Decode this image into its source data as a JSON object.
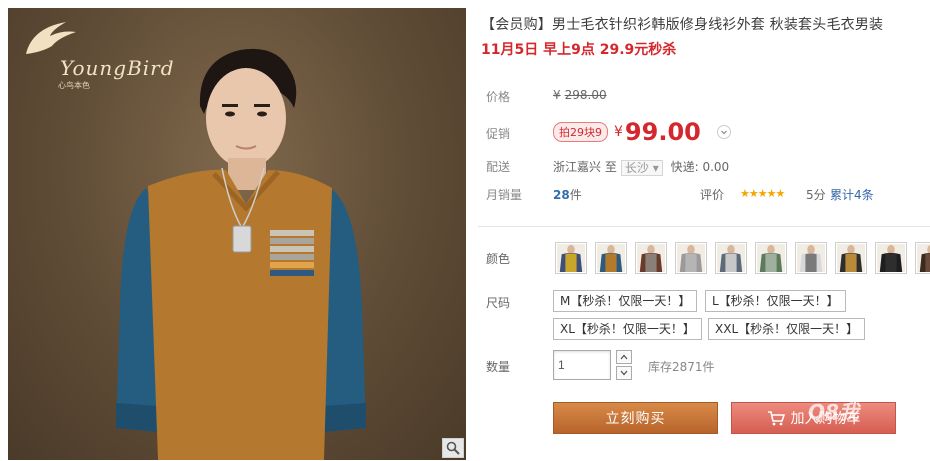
{
  "brand": {
    "logo_text": "YoungBird",
    "logo_sub": "心鸟本色"
  },
  "product": {
    "title": "【会员购】男士毛衣针织衫韩版修身线衫外套 秋装套头毛衣男装",
    "promo": "11月5日 早上9点 29.9元秒杀"
  },
  "price": {
    "label": "价格",
    "currency": "¥",
    "original": "298.00",
    "sale_label": "促销",
    "badge": "拍29块9",
    "sale_currency": "¥",
    "sale_value": "99.00"
  },
  "shipping": {
    "label": "配送",
    "from": "浙江嘉兴",
    "to_word": "至",
    "city": "长沙",
    "fee_label": "快递:",
    "fee": "0.00"
  },
  "sales": {
    "label": "月销量",
    "count": "28",
    "unit": "件",
    "rating_label": "评价",
    "stars": "★★★★★",
    "score": "5分",
    "reviews": "累计4条"
  },
  "color": {
    "label": "颜色",
    "swatches": [
      {
        "name": "swatch-1",
        "body": "#c9a62a",
        "sleeve": "#3d4f7a"
      },
      {
        "name": "swatch-2",
        "body": "#b47a2c",
        "sleeve": "#2b5b7e"
      },
      {
        "name": "swatch-3",
        "body": "#8a8078",
        "sleeve": "#6a3a2a"
      },
      {
        "name": "swatch-4",
        "body": "#b5b5b5",
        "sleeve": "#9a9a9a"
      },
      {
        "name": "swatch-5",
        "body": "#c8c8c8",
        "sleeve": "#5d6a7a"
      },
      {
        "name": "swatch-6",
        "body": "#9fb0a0",
        "sleeve": "#5c7a5c"
      },
      {
        "name": "swatch-7",
        "body": "#7a7a7a",
        "sleeve": "#d8d8d8"
      },
      {
        "name": "swatch-8",
        "body": "#b88a3a",
        "sleeve": "#2e2e2e"
      },
      {
        "name": "swatch-9",
        "body": "#2e2e2e",
        "sleeve": "#1e1e1e"
      },
      {
        "name": "swatch-10",
        "body": "#6a4a3a",
        "sleeve": "#3a2a20"
      }
    ]
  },
  "size": {
    "label": "尺码",
    "options": [
      "M【秒杀！仅限一天！】",
      "L【秒杀！仅限一天！】",
      "XL【秒杀！仅限一天！】",
      "XXL【秒杀！仅限一天！】"
    ]
  },
  "quantity": {
    "label": "数量",
    "value": "1",
    "stock": "库存2871件"
  },
  "actions": {
    "buy": "立刻购买",
    "cart": "加入购物车",
    "watermark": "Q8我"
  },
  "colors": {
    "accent": "#d4282d",
    "buy": "#c6743a",
    "cart": "#e07468",
    "link": "#3366aa"
  }
}
